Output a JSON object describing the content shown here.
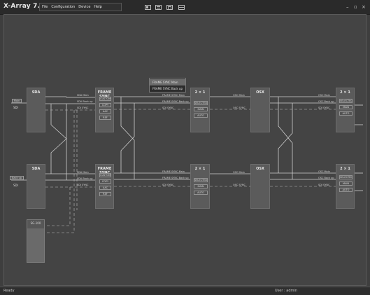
{
  "app": {
    "title": "X-Array 7.0"
  },
  "menu": [
    "File",
    "Configuration",
    "Device",
    "Help"
  ],
  "toolbar_icons": [
    "layout-icon",
    "list-icon",
    "window-icon",
    "panel-icon"
  ],
  "window_controls": {
    "minimize": "–",
    "restore": "▫",
    "close": "×"
  },
  "inputs": {
    "top": {
      "box": "Main",
      "label": "SDI"
    },
    "bottom": {
      "box": "Back up",
      "label": "SDI"
    }
  },
  "rows": [
    {
      "sda": {
        "title": "SDA",
        "ports": [
          "SDA Main",
          "SDA Back up",
          "SDI SYNC"
        ]
      },
      "fsync": {
        "title": "FRAME SYNC",
        "ports": [
          "CUSTOM",
          "COPY",
          "AAC",
          "REF"
        ]
      },
      "sw1": {
        "title": "2 × 1",
        "in_labels": [
          "FRAME SYNC Main",
          "FRAME SYNC Back up",
          "SDI SYNC"
        ],
        "ports": [
          "SELECTED",
          "MAIN",
          "AUTO"
        ]
      },
      "osx": {
        "title": "OSX",
        "in_labels": [
          "OSC Main",
          "OSC SYNC"
        ]
      },
      "sw2": {
        "title": "2 × 1",
        "in_labels": [
          "OSC Main",
          "OSC Back up",
          "SDI SYNC"
        ],
        "ports": [
          "SELECTED",
          "MAIN",
          "AUTO"
        ]
      }
    },
    {
      "sda": {
        "title": "SDA",
        "ports": [
          "SDA Main",
          "SDA Back up",
          "SDI SYNC"
        ]
      },
      "fsync": {
        "title": "FRAME SYNC",
        "ports": [
          "CUSTOM",
          "COPY",
          "AAC",
          "REF"
        ]
      },
      "sw1": {
        "title": "2 × 1",
        "in_labels": [
          "FRAME SYNC Main",
          "FRAME SYNC Back up",
          "SDI SYNC"
        ],
        "ports": [
          "SELECTED",
          "MAIN",
          "AUTO"
        ]
      },
      "osx": {
        "title": "OSX",
        "in_labels": [
          "OSC Main",
          "OSC SYNC"
        ]
      },
      "sw2": {
        "title": "2 × 1",
        "in_labels": [
          "OSC Main",
          "OSC Back up",
          "SDI SYNC"
        ],
        "ports": [
          "SELECTED",
          "MAIN",
          "AUTO"
        ]
      }
    }
  ],
  "sync_box": {
    "title": "SG-100"
  },
  "popup": {
    "items": [
      "FRAME SYNC Main",
      "FRAME SYNC Back up"
    ]
  },
  "status": {
    "left": "Ready",
    "right": "User : admin"
  }
}
